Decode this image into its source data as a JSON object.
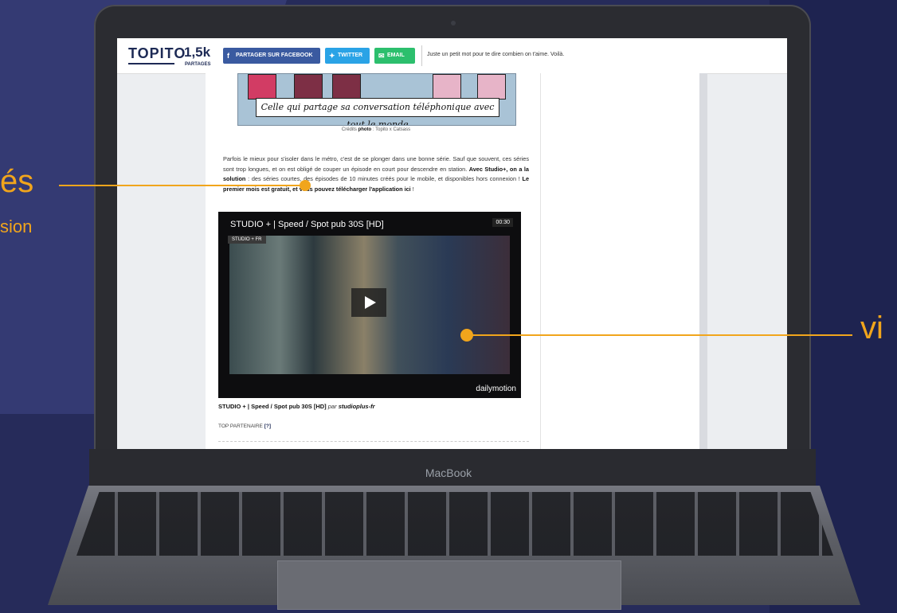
{
  "device": {
    "brand": "MacBook"
  },
  "header": {
    "logo": "TOPITO",
    "share_count": "1,5k",
    "share_label": "PARTAGES",
    "facebook_label": "PARTAGER SUR FACEBOOK",
    "twitter_label": "TWITTER",
    "email_label": "EMAIL",
    "tagline": "Juste un petit mot pour te dire combien on t'aime. Voilà."
  },
  "article": {
    "comic_caption": "Celle qui partage sa conversation téléphonique avec tout le monde",
    "credit_prefix": "Crédits",
    "credit_bold": "photo",
    "credit_suffix": ": Topito x Catsass",
    "paragraph": {
      "p1": "Parfois le mieux pour s'isoler dans le métro, c'est de se plonger dans une bonne série. Sauf que souvent, ces séries sont trop longues, et on est obligé de couper un épisode en court pour descendre en station.",
      "p2": "Avec Studio+, on a la solution",
      "p3": ": des séries courtes, des épisodes de 10 minutes créés pour le mobile, et disponibles hors connexion !",
      "p4": "Le premier mois est gratuit, et vous pouvez télécharger l'application ici",
      "p5": "!"
    },
    "video": {
      "title": "STUDIO + | Speed / Spot pub 30S [HD]",
      "duration": "00:30",
      "channel": "STUDIO + FR",
      "provider": "dailymotion"
    },
    "video_caption": {
      "title": "STUDIO + | Speed / Spot pub 30S [HD]",
      "par": "par",
      "author": "studioplus-fr"
    },
    "partner_label": "TOP PARTENAIRE",
    "partner_link": "[?]"
  },
  "annotations": {
    "left_word": "és",
    "left_sub": "sion",
    "right_word": "vi",
    "color": "#f1a51c"
  }
}
